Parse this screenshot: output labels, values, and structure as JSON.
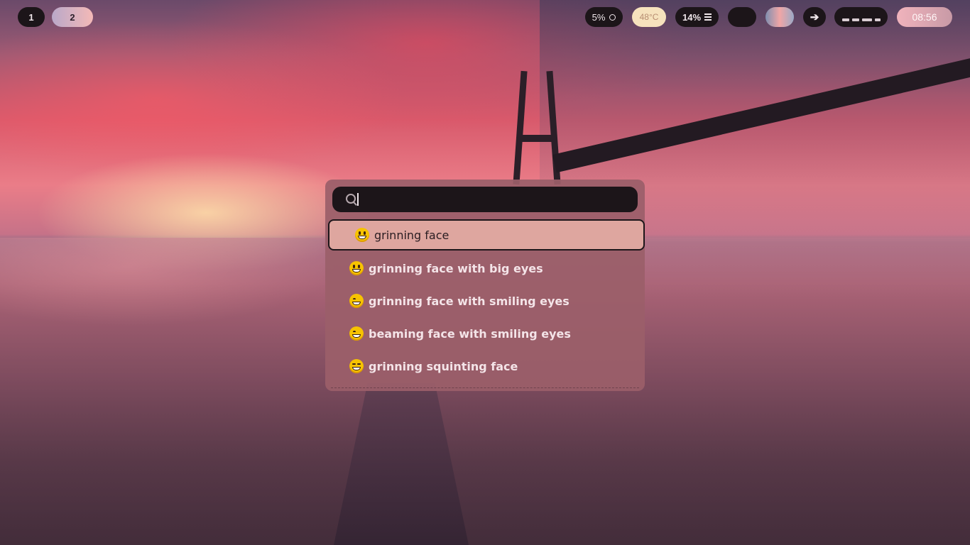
{
  "top_bar": {
    "workspaces": [
      {
        "label": "1"
      },
      {
        "label": "2"
      }
    ],
    "cpu": "5%",
    "temperature": "48°C",
    "memory": "14%",
    "clock": "08:56"
  },
  "launcher": {
    "search": {
      "value": "",
      "icon": "search-icon"
    },
    "results": [
      {
        "label": "grinning face",
        "emoji": "😀",
        "selected": true
      },
      {
        "label": "grinning face with big eyes",
        "emoji": "😃",
        "selected": false
      },
      {
        "label": "grinning face with smiling eyes",
        "emoji": "😄",
        "selected": false
      },
      {
        "label": "beaming face with smiling eyes",
        "emoji": "😁",
        "selected": false
      },
      {
        "label": "grinning squinting face",
        "emoji": "😆",
        "selected": false
      }
    ]
  },
  "colors": {
    "bar_dark": "#1c1519",
    "launcher_bg": "#9b5f69",
    "selected_bg": "#e2aaa2",
    "temp_bg": "#f6e2bd"
  }
}
